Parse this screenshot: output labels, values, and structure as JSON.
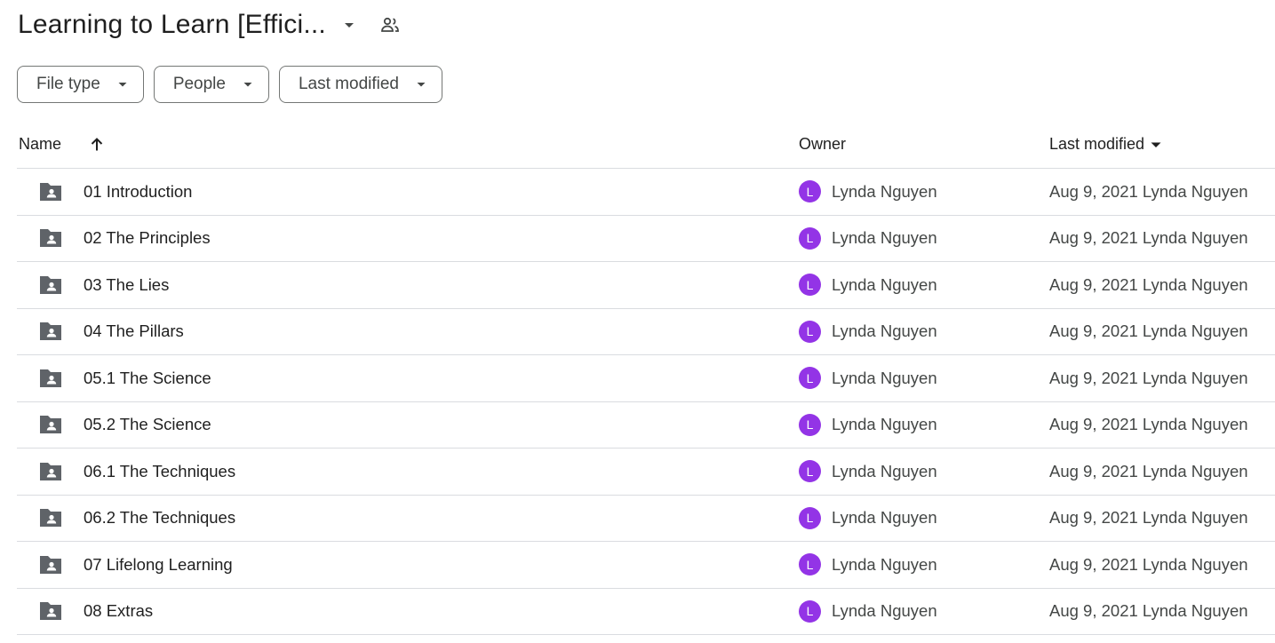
{
  "header": {
    "title": "Learning to Learn [Effici...",
    "caret_icon": "arrow-drop-down-icon",
    "shared_icon": "people-icon"
  },
  "filters": [
    {
      "label": "File type"
    },
    {
      "label": "People"
    },
    {
      "label": "Last modified"
    }
  ],
  "table": {
    "columns": {
      "name": "Name",
      "owner": "Owner",
      "last_modified": "Last modified"
    },
    "sort_icon": "arrow-upward-icon",
    "rows": [
      {
        "name": "01 Introduction",
        "owner_initial": "L",
        "owner": "Lynda Nguyen",
        "modified": "Aug 9, 2021 Lynda Nguyen"
      },
      {
        "name": "02 The Principles",
        "owner_initial": "L",
        "owner": "Lynda Nguyen",
        "modified": "Aug 9, 2021 Lynda Nguyen"
      },
      {
        "name": "03 The Lies",
        "owner_initial": "L",
        "owner": "Lynda Nguyen",
        "modified": "Aug 9, 2021 Lynda Nguyen"
      },
      {
        "name": "04 The Pillars",
        "owner_initial": "L",
        "owner": "Lynda Nguyen",
        "modified": "Aug 9, 2021 Lynda Nguyen"
      },
      {
        "name": "05.1 The Science",
        "owner_initial": "L",
        "owner": "Lynda Nguyen",
        "modified": "Aug 9, 2021 Lynda Nguyen"
      },
      {
        "name": "05.2 The Science",
        "owner_initial": "L",
        "owner": "Lynda Nguyen",
        "modified": "Aug 9, 2021 Lynda Nguyen"
      },
      {
        "name": "06.1 The Techniques",
        "owner_initial": "L",
        "owner": "Lynda Nguyen",
        "modified": "Aug 9, 2021 Lynda Nguyen"
      },
      {
        "name": "06.2 The Techniques",
        "owner_initial": "L",
        "owner": "Lynda Nguyen",
        "modified": "Aug 9, 2021 Lynda Nguyen"
      },
      {
        "name": "07 Lifelong Learning",
        "owner_initial": "L",
        "owner": "Lynda Nguyen",
        "modified": "Aug 9, 2021 Lynda Nguyen"
      },
      {
        "name": "08 Extras",
        "owner_initial": "L",
        "owner": "Lynda Nguyen",
        "modified": "Aug 9, 2021 Lynda Nguyen"
      }
    ]
  },
  "colors": {
    "avatar": "#9334e6",
    "folder_icon": "#5f6368",
    "divider": "#dadce0"
  }
}
